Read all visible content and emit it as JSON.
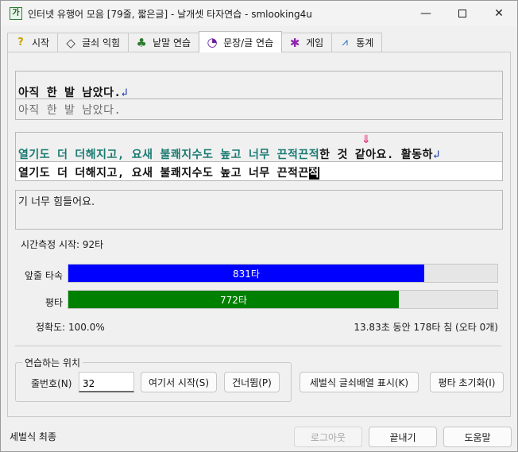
{
  "window": {
    "title": "인터넷 유행어 모음 [79줄, 짧은글] - 날개셋 타자연습 - smlooking4u",
    "app_icon_glyph": "가",
    "minimize": "—",
    "close": "✕"
  },
  "tabs": [
    {
      "label": "시작",
      "icon": "question-icon",
      "glyph": "?",
      "color": "#c8a100"
    },
    {
      "label": "글쇠 익힘",
      "icon": "diamond-icon",
      "glyph": "◇",
      "color": "#333333"
    },
    {
      "label": "낱말 연습",
      "icon": "tree-icon",
      "glyph": "♣",
      "color": "#2e7d32"
    },
    {
      "label": "문장/글 연습",
      "icon": "clock-icon",
      "glyph": "◔",
      "color": "#6a1b9a",
      "active": true
    },
    {
      "label": "게임",
      "icon": "game-icon",
      "glyph": "✱",
      "color": "#8e24aa"
    },
    {
      "label": "통계",
      "icon": "chart-icon",
      "glyph": "⩘",
      "color": "#1565c0"
    }
  ],
  "sentence": {
    "target": "아직 한 발 남았다.",
    "enter_mark": "↲",
    "typed": "아직 한 발 남았다."
  },
  "paragraph": {
    "target_done": "열기도 더 더해지고, 요새 불쾌지수도 높고 너무 끈적끈적",
    "target_rest": "한 것 같아요. 활동하",
    "enter_mark": "↲",
    "arrow": "⇓",
    "typed": "열기도 더 더해지고, 요새 불쾌지수도 높고 너무 끈적끈",
    "cursor": "적"
  },
  "next_line": "기 너무 힘들어요.",
  "timer": "시간측정 시작: 92타",
  "bars": [
    {
      "label": "앞줄 타속",
      "value": 831,
      "text": "831타",
      "color": "#0000ff",
      "fraction": 0.829
    },
    {
      "label": "평타",
      "value": 772,
      "text": "772타",
      "color": "#008000",
      "fraction": 0.77
    }
  ],
  "accuracy": "정확도: 100.0%",
  "stats": "13.83초 동안 178타 침 (오타 0개)",
  "position_group": {
    "title": "연습하는 위치",
    "line_label": "줄번호(N)",
    "line_value": "32",
    "start_here": "여기서 시작(S)",
    "skip": "건너뜀(P)"
  },
  "buttons": {
    "show_layout": "세벌식 글쇠배열 표시(K)",
    "reset_avg": "평타 초기화(I)",
    "logout": "로그아웃",
    "exit": "끝내기",
    "help": "도움말"
  },
  "status": "세벌식 최종"
}
